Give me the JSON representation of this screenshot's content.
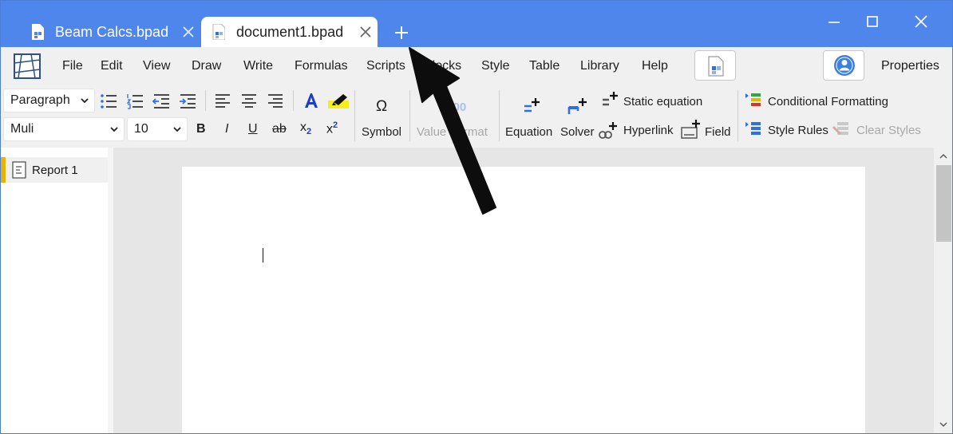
{
  "tabs": [
    {
      "label": "Beam Calcs.bpad",
      "active": false
    },
    {
      "label": "document1.bpad",
      "active": true
    }
  ],
  "menu": [
    "File",
    "Edit",
    "View",
    "Draw",
    "Write",
    "Formulas",
    "Scripts",
    "Blocks",
    "Style",
    "Table",
    "Library",
    "Help"
  ],
  "properties_label": "Properties",
  "ribbon": {
    "paragraph_style": "Paragraph",
    "font_family": "Muli",
    "font_size": "10",
    "bold": "B",
    "italic": "I",
    "underline": "U",
    "strike": "ab",
    "subscript": "x",
    "subscript_small": "2",
    "superscript": "x",
    "superscript_small": "2",
    "symbol_glyph": "Ω",
    "symbol_label": "Symbol",
    "value_format_glyph": "0.00",
    "value_format_label": "Value Format",
    "equation_label": "Equation",
    "solver_label": "Solver",
    "static_equation_label": "Static equation",
    "hyperlink_label": "Hyperlink",
    "field_label": "Field",
    "conditional_formatting_label": "Conditional Formatting",
    "style_rules_label": "Style Rules",
    "clear_styles_label": "Clear Styles"
  },
  "sidebar": {
    "items": [
      {
        "label": "Report 1"
      }
    ]
  },
  "colors": {
    "titlebar": "#4f86ec",
    "accent_blue": "#2f6fe0",
    "report_marker": "#e8b400"
  }
}
